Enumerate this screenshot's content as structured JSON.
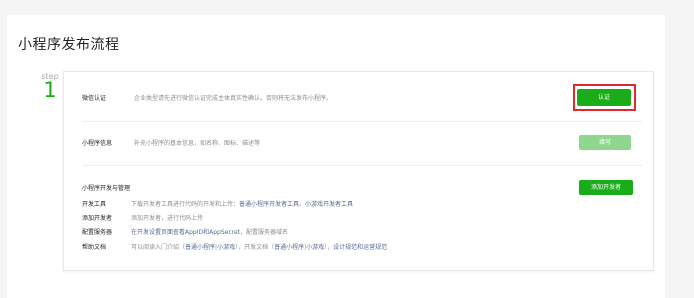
{
  "page_title": "小程序发布流程",
  "step": {
    "label": "step",
    "number": "1"
  },
  "wechat_verify": {
    "label": "微信认证",
    "desc": "企业类型请先进行微信认证完成主体真实性确认。否则将无法发布小程序。",
    "button": "认证"
  },
  "mini_info": {
    "label": "小程序信息",
    "desc": "补充小程序的基本信息，如名称、图标、描述等",
    "button": "填写"
  },
  "dev_manage": {
    "label": "小程序开发与管理",
    "button": "添加开发者",
    "tools": {
      "label": "开发工具",
      "text": "下载开发者工具进行代码的开发和上传：",
      "link1": "普通小程序开发者工具",
      "sep": "、",
      "link2": "小游戏开发者工具"
    },
    "add_dev": {
      "label": "添加开发者",
      "text": "添加开发者，进行代码上传"
    },
    "server": {
      "label": "配置服务器",
      "link": "在开发设置页面查看AppID和AppSecret",
      "text": "，配置服务器域名"
    },
    "docs": {
      "label": "帮助文档",
      "t1": "可以阅读入门介绍（",
      "l1": "普通小程序",
      "s1": "|",
      "l2": "小游戏",
      "t2": "），开发文档（",
      "l3": "普通小程序",
      "s2": "|",
      "l4": "小游戏",
      "t3": "），",
      "l5": "设计规范和运营规范"
    }
  },
  "colors": {
    "brand_green": "#1aad19",
    "disabled_green": "#8fd68e",
    "highlight_red": "#e0282e",
    "link_blue": "#576b95"
  }
}
